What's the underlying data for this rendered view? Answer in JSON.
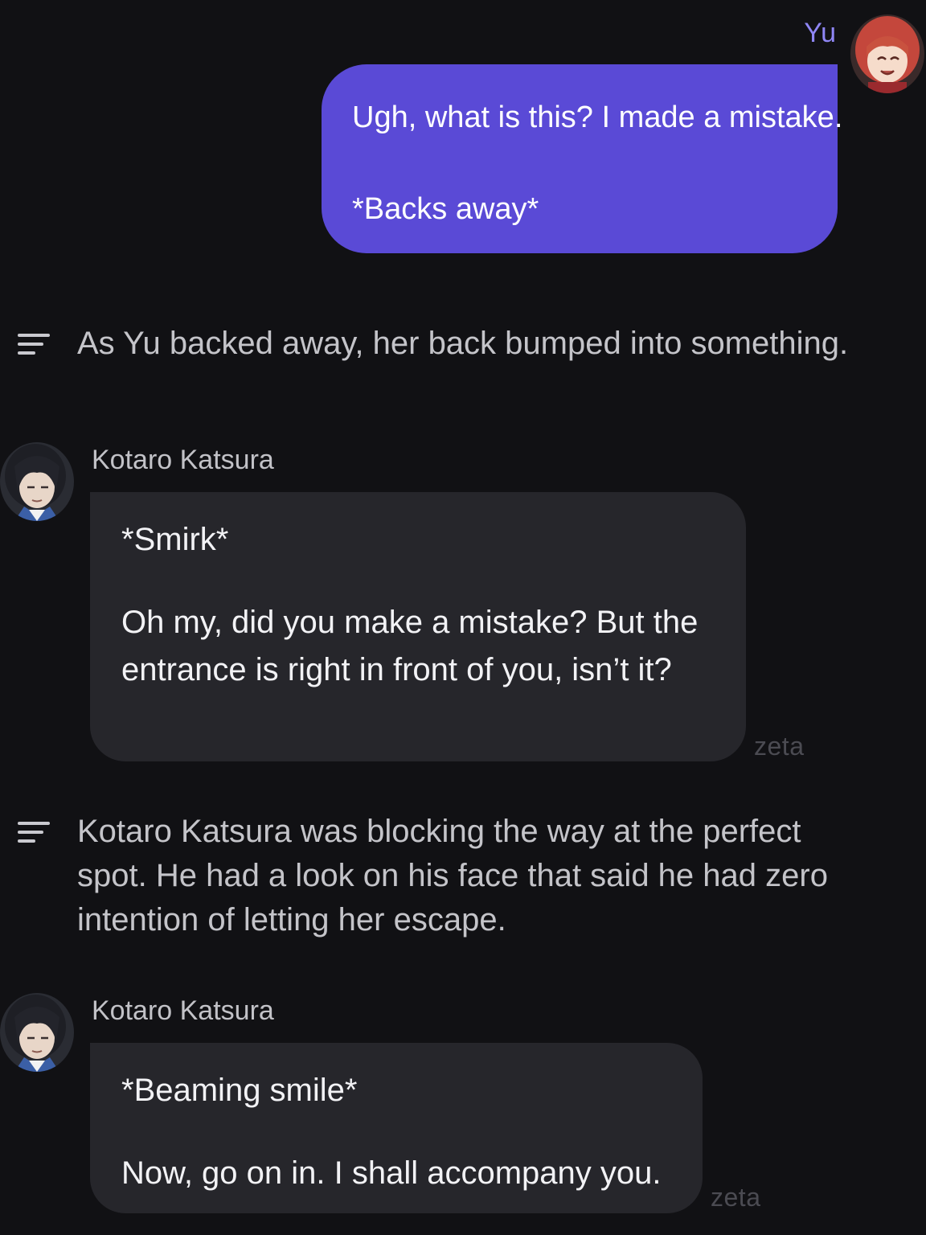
{
  "user_message": {
    "sender": "Yu",
    "lines": [
      "Ugh, what is this? I made a mistake.",
      "*Backs away*"
    ],
    "bubble_color": "#5a4ad6",
    "name_color": "#8f86f5"
  },
  "narration_1": {
    "icon": "narration-lines-icon",
    "text": "As Yu backed away, her back bumped into something."
  },
  "bot_message_1": {
    "sender": "Kotaro Katsura",
    "lines": [
      "*Smirk*",
      "Oh my, did you make a mistake? But the entrance is right in front of you, isn’t it?"
    ],
    "brand": "zeta"
  },
  "narration_2": {
    "icon": "narration-lines-icon",
    "text": "Kotaro Katsura was blocking the way at the perfect spot. He had a look on his face that said he had zero intention of letting her escape."
  },
  "bot_message_2": {
    "sender": "Kotaro Katsura",
    "lines": [
      "*Beaming smile*",
      "Now, go on in. I shall accompany you."
    ],
    "brand": "zeta"
  },
  "colors": {
    "background": "#111114",
    "bot_bubble": "#26262b",
    "narration_text": "#c4c4c9"
  }
}
